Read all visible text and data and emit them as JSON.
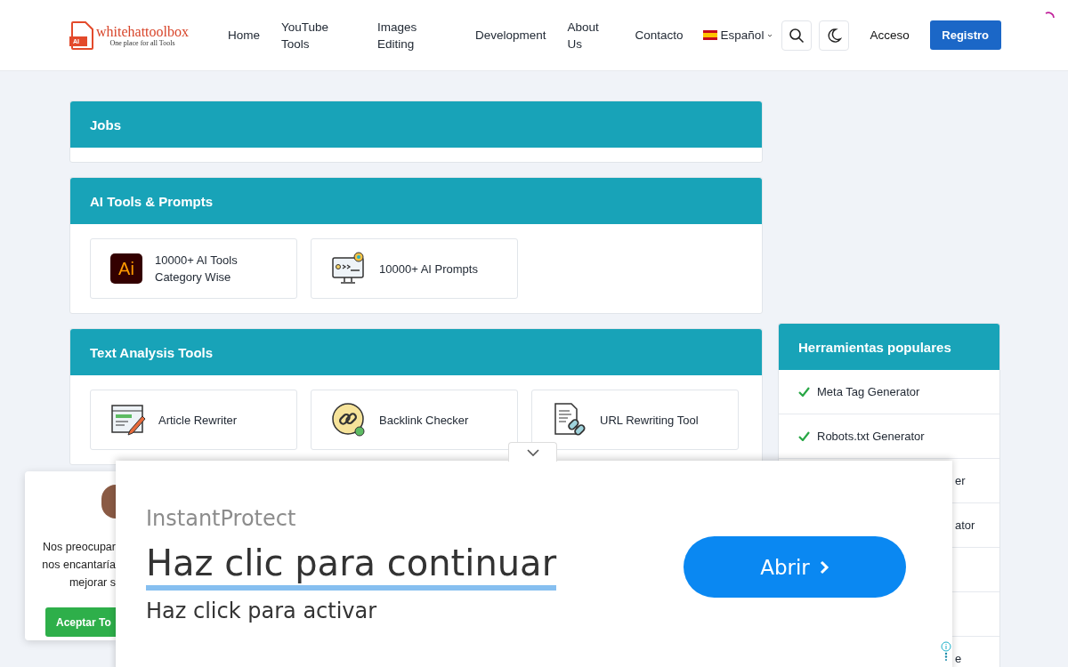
{
  "header": {
    "logo": {
      "name": "whitehattoolbox",
      "tagline": "One place for all Tools",
      "badge": "AI"
    },
    "nav": [
      "Home",
      "YouTube Tools",
      "Images Editing",
      "Development",
      "About Us",
      "Contacto"
    ],
    "language": "Español",
    "login": "Acceso",
    "register": "Registro"
  },
  "sections": [
    {
      "title": "Jobs"
    },
    {
      "title": "AI Tools & Prompts",
      "tools": [
        {
          "label": "10000+ AI Tools Category Wise",
          "kind": "ai",
          "icon_text": "Ai"
        },
        {
          "label": "10000+ AI Prompts",
          "kind": "prompt"
        }
      ]
    },
    {
      "title": "Text Analysis Tools",
      "tools": [
        {
          "label": "Article Rewriter",
          "kind": "rewriter"
        },
        {
          "label": "Backlink Checker",
          "kind": "backlink"
        },
        {
          "label": "URL Rewriting Tool",
          "kind": "url"
        }
      ]
    }
  ],
  "sidebar": {
    "title": "Herramientas populares",
    "items": [
      {
        "kind": "full",
        "label": "Meta Tag Generator"
      },
      {
        "kind": "full",
        "label": "Robots.txt Generator"
      },
      {
        "kind": "cut",
        "label": "er"
      },
      {
        "kind": "cut",
        "label": "ator"
      },
      {
        "kind": "cut"
      },
      {
        "kind": "cut"
      },
      {
        "kind": "cut",
        "label": "e"
      }
    ]
  },
  "cookie": {
    "lines": [
      "Nos preocupar",
      "nos encantaría",
      "mejorar s"
    ],
    "button": "Aceptar To"
  },
  "ad": {
    "brand": "InstantProtect",
    "headline": "Haz clic para continuar",
    "subline": "Haz click para activar",
    "button": "Abrir"
  }
}
